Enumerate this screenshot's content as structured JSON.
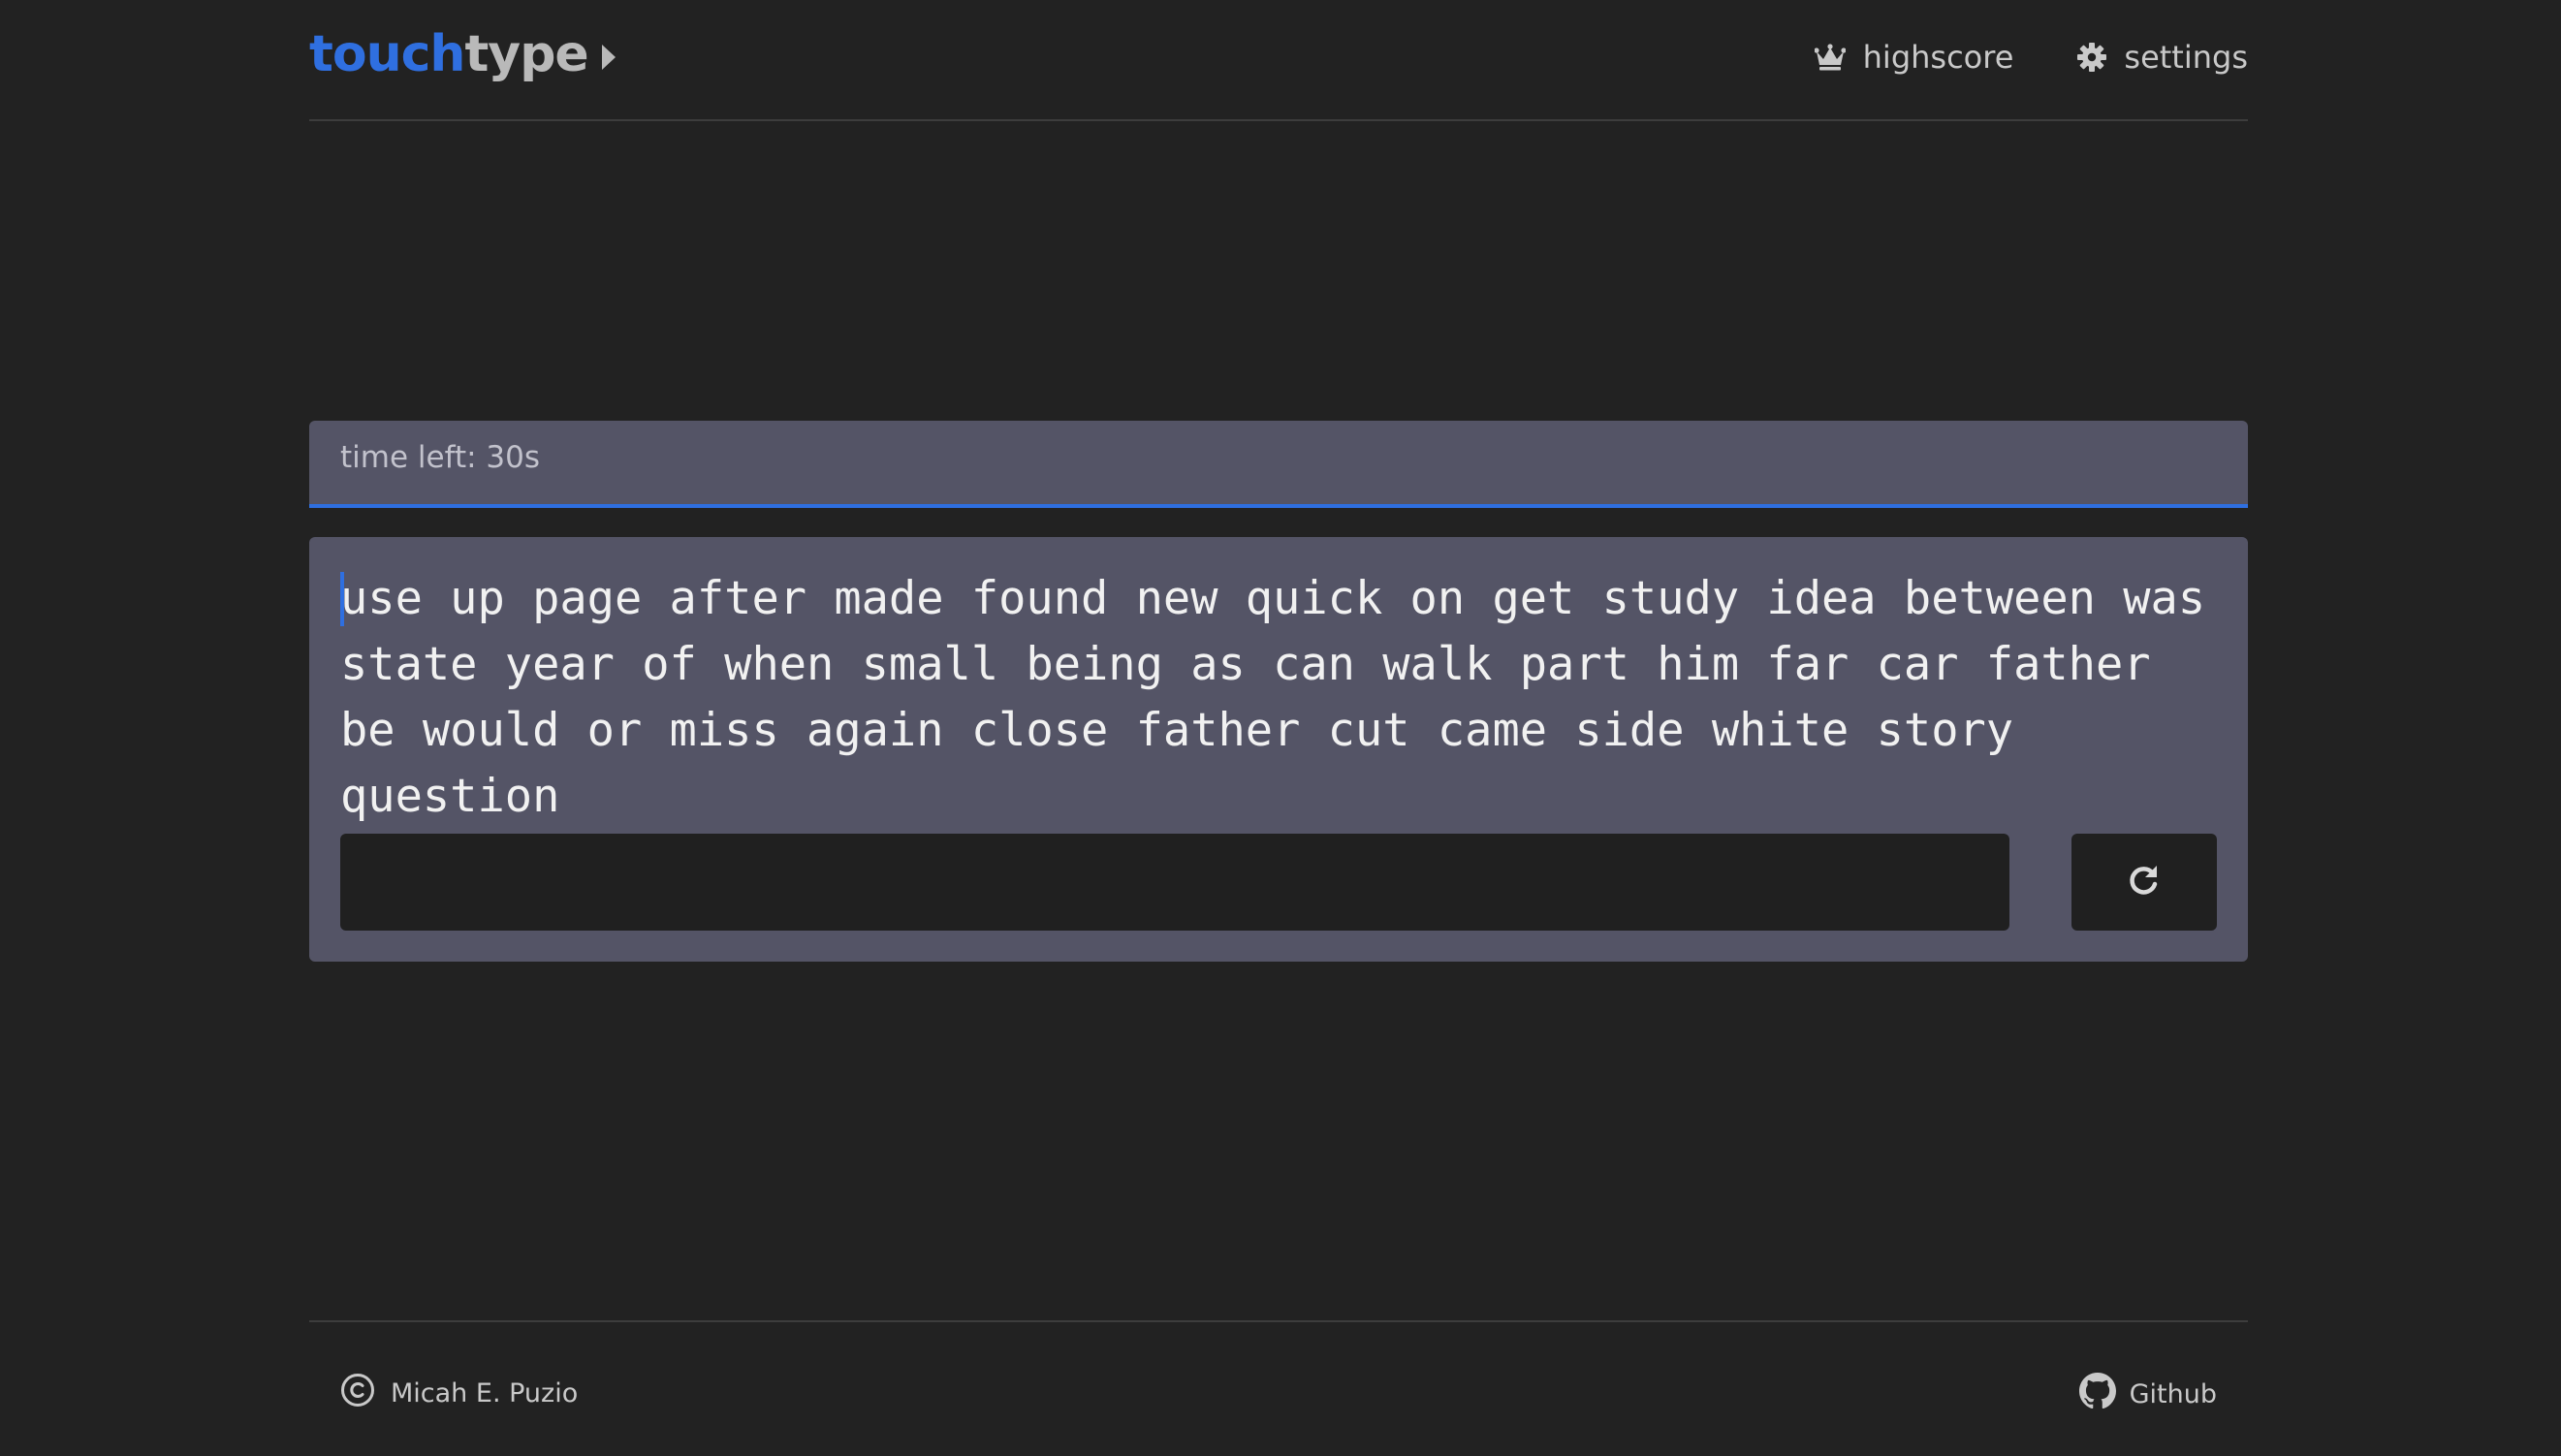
{
  "header": {
    "logo_part1": "touch",
    "logo_part2": "type",
    "logo_icon": "caret-right-icon",
    "nav": [
      {
        "label": "highscore",
        "icon": "crown-icon"
      },
      {
        "label": "settings",
        "icon": "gear-icon"
      }
    ]
  },
  "timer": {
    "label": "time left: 30s"
  },
  "typing": {
    "words": "use up page after made found new quick on get study idea between was state year of when small being as can walk part him far car father be would or miss again close father cut came side white story question",
    "input_value": "",
    "restart_icon": "redo-icon"
  },
  "footer": {
    "author": "Micah E. Puzio",
    "author_icon": "copyright-icon",
    "github_label": "Github",
    "github_icon": "github-icon"
  },
  "colors": {
    "background": "#222222",
    "panel": "#545466",
    "accent": "#2f6fe0",
    "input": "#202020",
    "text": "#f1f1f1"
  }
}
